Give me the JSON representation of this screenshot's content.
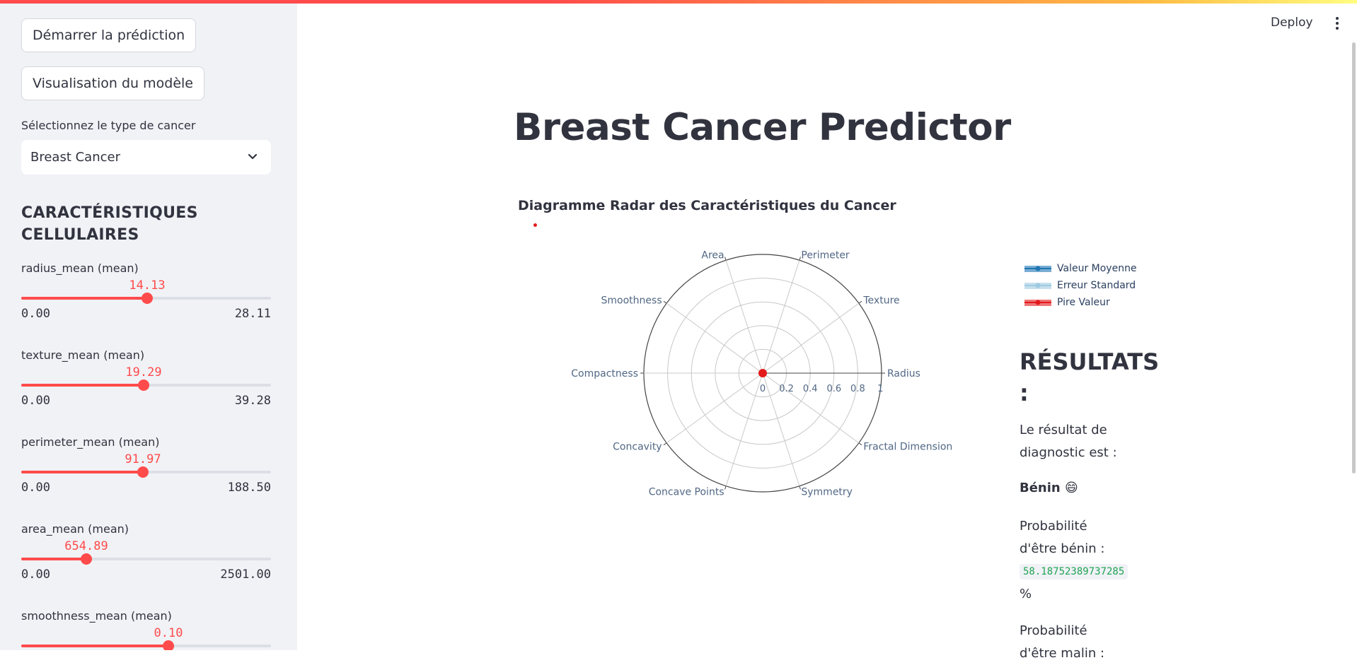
{
  "header": {
    "deploy_label": "Deploy"
  },
  "sidebar": {
    "predict_button": "Démarrer la prédiction",
    "model_button": "Visualisation du modèle",
    "select_label": "Sélectionnez le type de cancer",
    "select_value": "Breast Cancer",
    "section_heading": "CARACTÉRISTIQUES CELLULAIRES",
    "sliders": [
      {
        "label": "radius_mean (mean)",
        "value": "14.13",
        "min": "0.00",
        "max": "28.11",
        "fraction": 0.503
      },
      {
        "label": "texture_mean (mean)",
        "value": "19.29",
        "min": "0.00",
        "max": "39.28",
        "fraction": 0.491
      },
      {
        "label": "perimeter_mean (mean)",
        "value": "91.97",
        "min": "0.00",
        "max": "188.50",
        "fraction": 0.488
      },
      {
        "label": "area_mean (mean)",
        "value": "654.89",
        "min": "0.00",
        "max": "2501.00",
        "fraction": 0.262
      },
      {
        "label": "smoothness_mean (mean)",
        "value": "0.10",
        "min": "",
        "max": "",
        "fraction": 0.59
      }
    ]
  },
  "main": {
    "title": "Breast Cancer Predictor",
    "chart_title": "Diagramme Radar des Caractéristiques du Cancer"
  },
  "chart_data": {
    "type": "radar",
    "categories": [
      "Radius",
      "Texture",
      "Perimeter",
      "Area",
      "Smoothness",
      "Compactness",
      "Concavity",
      "Concave Points",
      "Symmetry",
      "Fractal Dimension"
    ],
    "radial_ticks": [
      "0",
      "0.2",
      "0.4",
      "0.6",
      "0.8",
      "1"
    ],
    "range": [
      0,
      1
    ],
    "series": [
      {
        "name": "Valeur Moyenne",
        "color": "#1f77b4",
        "values": [
          0.01,
          0.01,
          0.01,
          0.01,
          0.01,
          0.01,
          0.01,
          0.01,
          0.01,
          0.01
        ]
      },
      {
        "name": "Erreur Standard",
        "color": "#9ecae1",
        "values": [
          0.005,
          0.005,
          0.005,
          0.005,
          0.005,
          0.005,
          0.005,
          0.005,
          0.005,
          0.005
        ]
      },
      {
        "name": "Pire Valeur",
        "color": "#e31a1c",
        "values": [
          0.02,
          0.02,
          0.02,
          0.02,
          0.02,
          0.02,
          0.02,
          0.02,
          0.02,
          0.02
        ]
      }
    ],
    "legend_position": "right"
  },
  "results": {
    "heading": "RÉSULTATS :",
    "diag_text": "Le résultat de diagnostic est :",
    "diagnosis": "Bénin 😄",
    "prob_benign_label": "Probabilité d'être bénin :",
    "prob_benign_value": "58.18752389737285",
    "percent": "%",
    "prob_malignant_label": "Probabilité d'être malin :"
  }
}
